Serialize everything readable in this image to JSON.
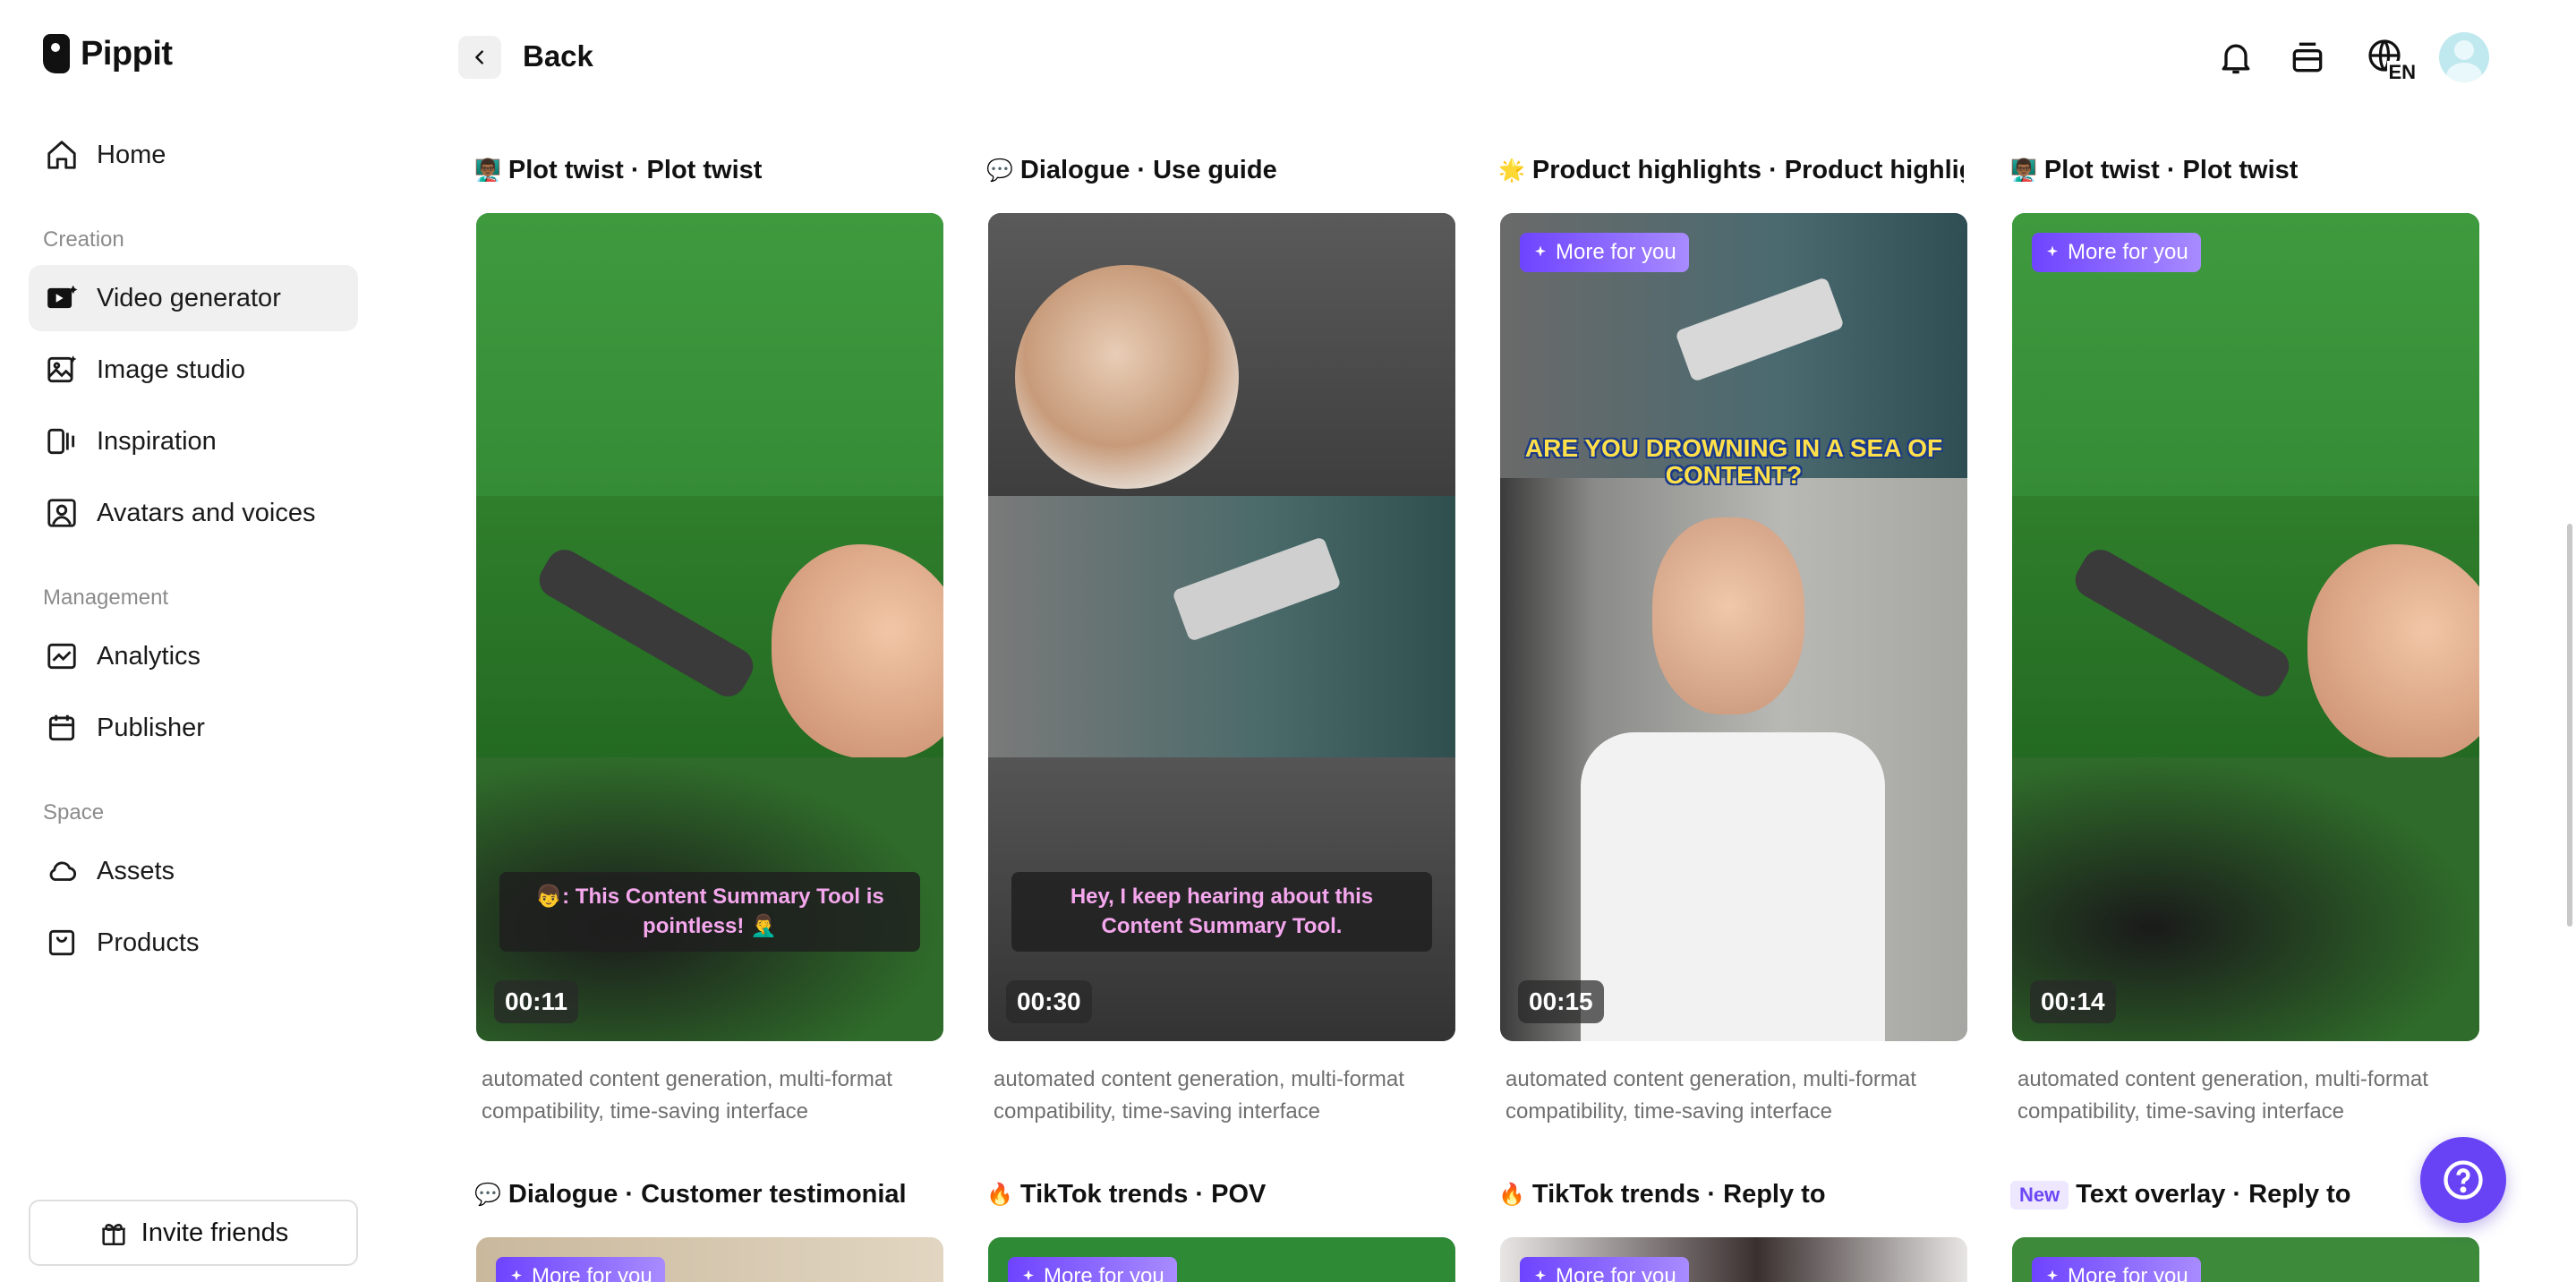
{
  "app": {
    "name": "Pippit"
  },
  "sidebar": {
    "home": "Home",
    "sections": {
      "creation": "Creation",
      "management": "Management",
      "space": "Space"
    },
    "items": {
      "video_generator": "Video generator",
      "image_studio": "Image studio",
      "inspiration": "Inspiration",
      "avatars_voices": "Avatars and voices",
      "analytics": "Analytics",
      "publisher": "Publisher",
      "assets": "Assets",
      "products": "Products"
    },
    "invite": "Invite friends"
  },
  "header": {
    "back": "Back",
    "language": "EN"
  },
  "cards": [
    {
      "emoji": "👨🏾‍🏫",
      "title": "Plot twist · Plot twist",
      "duration": "00:11",
      "caption": "👦: This Content Summary Tool is pointless! 🤦‍♂️",
      "description": "automated content generation, multi-format compatibility, time-saving interface"
    },
    {
      "emoji": "💬",
      "title": "Dialogue · Use guide",
      "duration": "00:30",
      "caption": "Hey, I keep hearing about this Content Summary Tool.",
      "description": "automated content generation, multi-format compatibility, time-saving interface"
    },
    {
      "emoji": "🌟",
      "title": "Product highlights · Product highlig...",
      "badge": "More for you",
      "overlay_text": "ARE YOU DROWNING IN A SEA OF CONTENT?",
      "duration": "00:15",
      "description": "automated content generation, multi-format compatibility, time-saving interface"
    },
    {
      "emoji": "👨🏾‍🏫",
      "title": "Plot twist · Plot twist",
      "badge": "More for you",
      "duration": "00:14",
      "description": "automated content generation, multi-format compatibility, time-saving interface"
    }
  ],
  "next_row": [
    {
      "emoji": "💬",
      "title": "Dialogue · Customer testimonial",
      "badge": "More for you"
    },
    {
      "emoji": "🔥",
      "title": "TikTok trends · POV",
      "badge": "More for you"
    },
    {
      "emoji": "🔥",
      "title": "TikTok trends · Reply to",
      "badge": "More for you"
    },
    {
      "tag": "New",
      "title": "Text overlay · Reply to",
      "badge": "More for you"
    }
  ]
}
